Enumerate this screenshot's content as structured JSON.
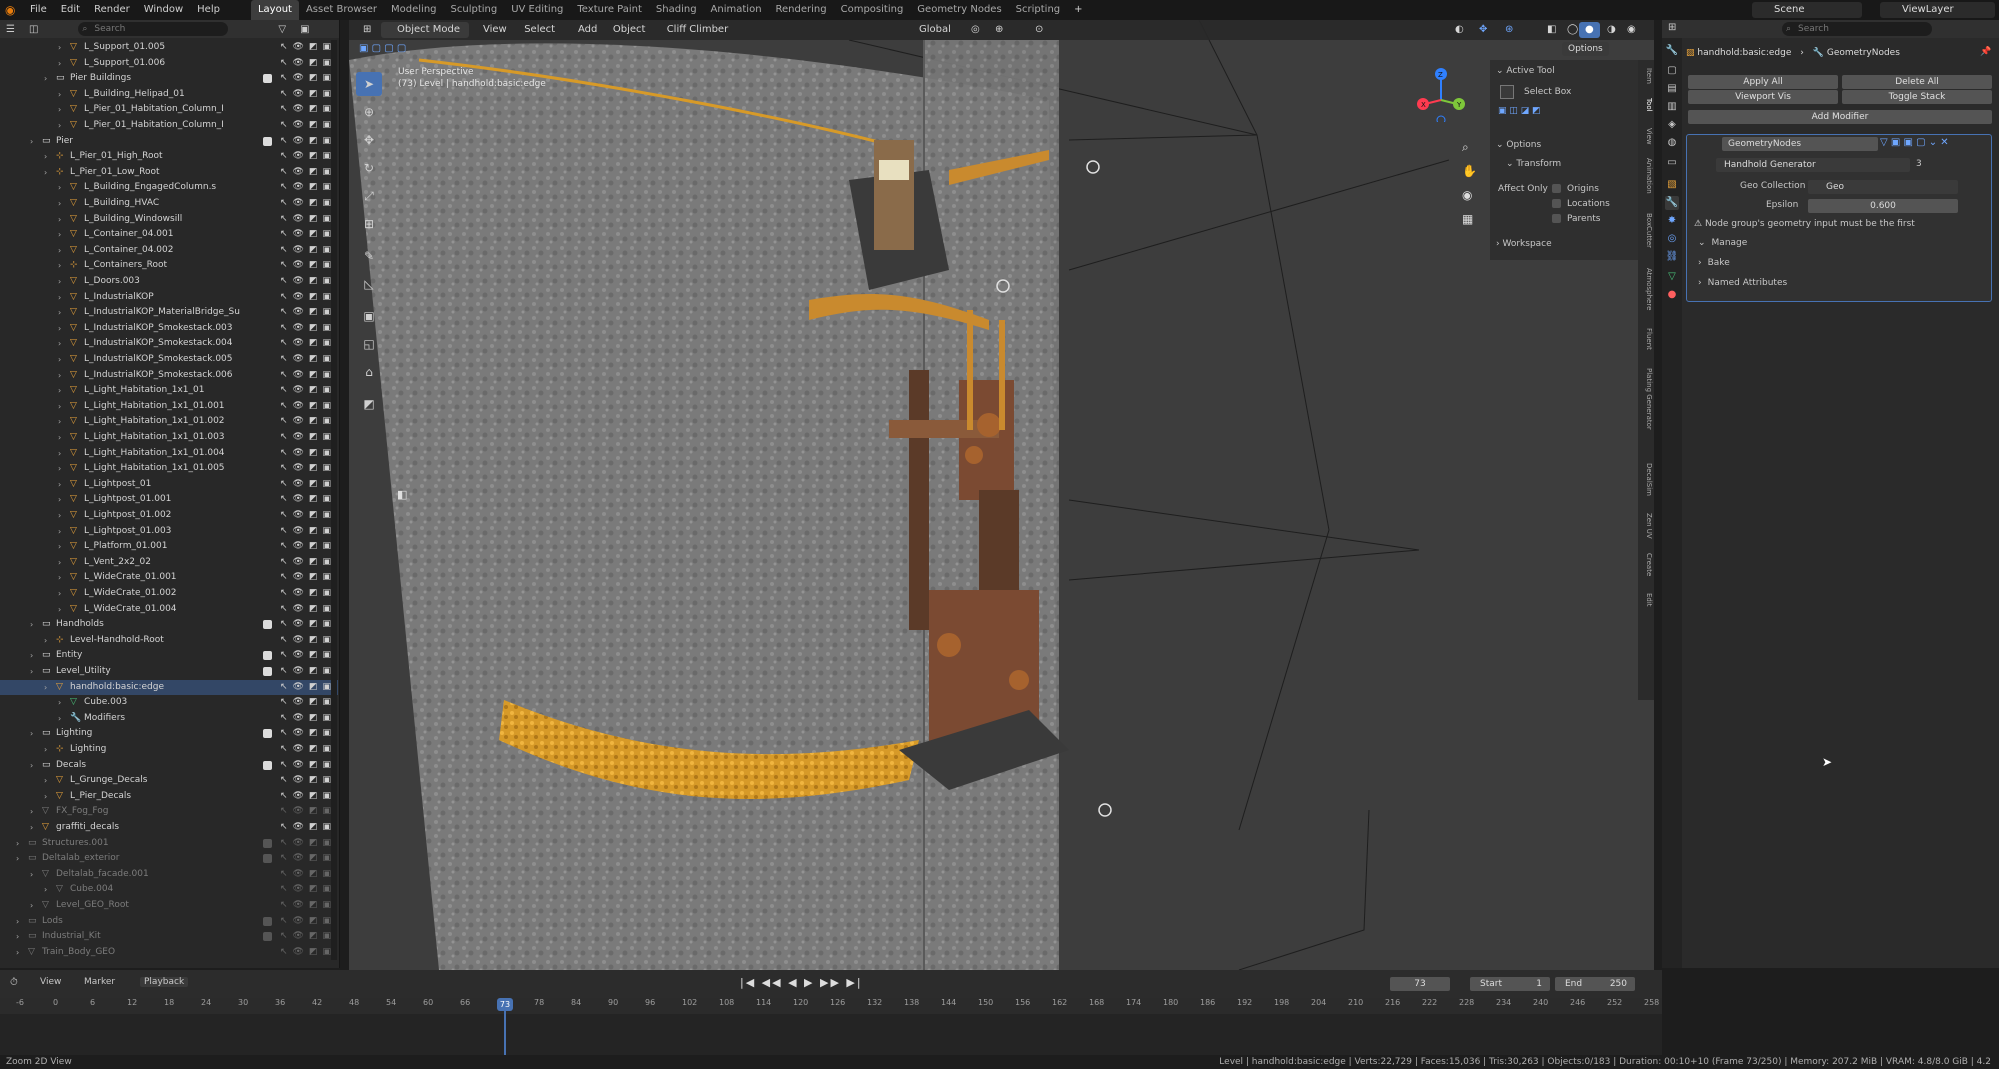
{
  "menu": [
    "File",
    "Edit",
    "Render",
    "Window",
    "Help"
  ],
  "workspaces": [
    "Layout",
    "Asset Browser",
    "Modeling",
    "Sculpting",
    "UV Editing",
    "Texture Paint",
    "Shading",
    "Animation",
    "Rendering",
    "Compositing",
    "Geometry Nodes",
    "Scripting"
  ],
  "active_workspace": "Layout",
  "scene": "Scene",
  "view_layer": "ViewLayer",
  "outliner": {
    "search_placeholder": "Search",
    "rows": [
      {
        "label": "L_Support_01.005",
        "depth": 3,
        "kind": "obj"
      },
      {
        "label": "L_Support_01.006",
        "depth": 3,
        "kind": "obj"
      },
      {
        "label": "Pier Buildings",
        "depth": 2,
        "kind": "col"
      },
      {
        "label": "L_Building_Helipad_01",
        "depth": 3,
        "kind": "obj"
      },
      {
        "label": "L_Pier_01_Habitation_Column_I",
        "depth": 3,
        "kind": "obj"
      },
      {
        "label": "L_Pier_01_Habitation_Column_I",
        "depth": 3,
        "kind": "obj"
      },
      {
        "label": "Pier",
        "depth": 1,
        "kind": "col"
      },
      {
        "label": "L_Pier_01_High_Root",
        "depth": 2,
        "kind": "empty"
      },
      {
        "label": "L_Pier_01_Low_Root",
        "depth": 2,
        "kind": "empty"
      },
      {
        "label": "L_Building_EngagedColumn.s",
        "depth": 3,
        "kind": "obj"
      },
      {
        "label": "L_Building_HVAC",
        "depth": 3,
        "kind": "obj"
      },
      {
        "label": "L_Building_Windowsill",
        "depth": 3,
        "kind": "obj"
      },
      {
        "label": "L_Container_04.001",
        "depth": 3,
        "kind": "obj"
      },
      {
        "label": "L_Container_04.002",
        "depth": 3,
        "kind": "obj"
      },
      {
        "label": "L_Containers_Root",
        "depth": 3,
        "kind": "empty"
      },
      {
        "label": "L_Doors.003",
        "depth": 3,
        "kind": "obj"
      },
      {
        "label": "L_IndustrialKOP",
        "depth": 3,
        "kind": "obj"
      },
      {
        "label": "L_IndustrialKOP_MaterialBridge_Su",
        "depth": 3,
        "kind": "obj"
      },
      {
        "label": "L_IndustrialKOP_Smokestack.003",
        "depth": 3,
        "kind": "obj"
      },
      {
        "label": "L_IndustrialKOP_Smokestack.004",
        "depth": 3,
        "kind": "obj"
      },
      {
        "label": "L_IndustrialKOP_Smokestack.005",
        "depth": 3,
        "kind": "obj"
      },
      {
        "label": "L_IndustrialKOP_Smokestack.006",
        "depth": 3,
        "kind": "obj"
      },
      {
        "label": "L_Light_Habitation_1x1_01",
        "depth": 3,
        "kind": "obj"
      },
      {
        "label": "L_Light_Habitation_1x1_01.001",
        "depth": 3,
        "kind": "obj"
      },
      {
        "label": "L_Light_Habitation_1x1_01.002",
        "depth": 3,
        "kind": "obj"
      },
      {
        "label": "L_Light_Habitation_1x1_01.003",
        "depth": 3,
        "kind": "obj"
      },
      {
        "label": "L_Light_Habitation_1x1_01.004",
        "depth": 3,
        "kind": "obj"
      },
      {
        "label": "L_Light_Habitation_1x1_01.005",
        "depth": 3,
        "kind": "obj"
      },
      {
        "label": "L_Lightpost_01",
        "depth": 3,
        "kind": "obj"
      },
      {
        "label": "L_Lightpost_01.001",
        "depth": 3,
        "kind": "obj"
      },
      {
        "label": "L_Lightpost_01.002",
        "depth": 3,
        "kind": "obj"
      },
      {
        "label": "L_Lightpost_01.003",
        "depth": 3,
        "kind": "obj"
      },
      {
        "label": "L_Platform_01.001",
        "depth": 3,
        "kind": "obj"
      },
      {
        "label": "L_Vent_2x2_02",
        "depth": 3,
        "kind": "obj"
      },
      {
        "label": "L_WideCrate_01.001",
        "depth": 3,
        "kind": "obj"
      },
      {
        "label": "L_WideCrate_01.002",
        "depth": 3,
        "kind": "obj"
      },
      {
        "label": "L_WideCrate_01.004",
        "depth": 3,
        "kind": "obj"
      },
      {
        "label": "Handholds",
        "depth": 1,
        "kind": "col"
      },
      {
        "label": "Level-Handhold-Root",
        "depth": 2,
        "kind": "empty"
      },
      {
        "label": "Entity",
        "depth": 1,
        "kind": "col"
      },
      {
        "label": "Level_Utility",
        "depth": 1,
        "kind": "col"
      },
      {
        "label": "handhold:basic:edge",
        "depth": 2,
        "kind": "obj"
      },
      {
        "label": "Cube.003",
        "depth": 3,
        "kind": "mesh"
      },
      {
        "label": "Modifiers",
        "depth": 3,
        "kind": "mod"
      },
      {
        "label": "Lighting",
        "depth": 1,
        "kind": "col"
      },
      {
        "label": "Lighting",
        "depth": 2,
        "kind": "empty"
      },
      {
        "label": "Decals",
        "depth": 1,
        "kind": "col"
      },
      {
        "label": "L_Grunge_Decals",
        "depth": 2,
        "kind": "obj"
      },
      {
        "label": "L_Pier_Decals",
        "depth": 2,
        "kind": "obj"
      },
      {
        "label": "FX_Fog_Fog",
        "depth": 1,
        "kind": "dim"
      },
      {
        "label": "graffiti_decals",
        "depth": 1,
        "kind": "obj"
      },
      {
        "label": "Structures.001",
        "depth": 0,
        "kind": "dimcol"
      },
      {
        "label": "Deltalab_exterior",
        "depth": 0,
        "kind": "dimcol"
      },
      {
        "label": "Deltalab_facade.001",
        "depth": 1,
        "kind": "dim"
      },
      {
        "label": "Cube.004",
        "depth": 2,
        "kind": "dim"
      },
      {
        "label": "Level_GEO_Root",
        "depth": 1,
        "kind": "dim"
      },
      {
        "label": "Lods",
        "depth": 0,
        "kind": "dimcol"
      },
      {
        "label": "Industrial_Kit",
        "depth": 0,
        "kind": "dimcol"
      },
      {
        "label": "Train_Body_GEO",
        "depth": 0,
        "kind": "dim"
      }
    ]
  },
  "viewport": {
    "mode": "Object Mode",
    "menus": [
      "View",
      "Select",
      "Add",
      "Object",
      "Cliff Climber"
    ],
    "transform_orientation": "Global",
    "options": "Options",
    "overlay_title": "User Perspective",
    "overlay_sub": "(73) Level | handhold:basic:edge"
  },
  "npanel": {
    "active_tool_header": "Active Tool",
    "tool_name": "Select Box",
    "options_header": "Options",
    "transform_header": "Transform",
    "affect_only": "Affect Only",
    "checks": [
      "Origins",
      "Locations",
      "Parents"
    ],
    "workspace_header": "Workspace",
    "tabs": [
      "Item",
      "Tool",
      "View",
      "Animation",
      "BoxCutter",
      "Atmosphere",
      "Fluent",
      "Plating Generator",
      "DecalSim",
      "Zen UV",
      "Create",
      "Edit"
    ]
  },
  "properties": {
    "search_placeholder": "Search",
    "breadcrumb_obj": "handhold:basic:edge",
    "breadcrumb_mod": "GeometryNodes",
    "apply_all": "Apply All",
    "delete_all": "Delete All",
    "viewport_vis": "Viewport Vis",
    "toggle_stack": "Toggle Stack",
    "add_modifier": "Add Modifier",
    "modifier_name": "GeometryNodes",
    "node_group": "Handhold Generator",
    "node_group_users": "3",
    "geo_collection_label": "Geo Collection",
    "geo_collection_value": "Geo",
    "epsilon_label": "Epsilon",
    "epsilon_value": "0.600",
    "warning": "Node group's geometry input must be the first",
    "sections": [
      "Manage",
      "Bake",
      "Named Attributes"
    ]
  },
  "timeline": {
    "menus": [
      "View",
      "Marker",
      "Playback"
    ],
    "current_frame": "73",
    "start_label": "Start",
    "start": "1",
    "end_label": "End",
    "end": "250",
    "ticks": [
      "-6",
      "0",
      "6",
      "12",
      "18",
      "24",
      "30",
      "36",
      "42",
      "48",
      "54",
      "60",
      "66",
      "73",
      "78",
      "84",
      "90",
      "96",
      "102",
      "108",
      "114",
      "120",
      "126",
      "132",
      "138",
      "144",
      "150",
      "156",
      "162",
      "168",
      "174",
      "180",
      "186",
      "192",
      "198",
      "204",
      "210",
      "216",
      "222",
      "228",
      "234",
      "240",
      "246",
      "252",
      "258"
    ]
  },
  "status": {
    "left": "Zoom 2D View",
    "right": "Level | handhold:basic:edge | Verts:22,729 | Faces:15,036 | Tris:30,263 | Objects:0/183 | Duration: 00:10+10 (Frame 73/250) | Memory: 207.2 MiB | VRAM: 4.8/8.0 GiB | 4.2"
  },
  "colors": {
    "accent": "#e87d0d",
    "object_orange": "#e8a33b",
    "mesh_green": "#49c279",
    "selection_blue": "#4772b3"
  }
}
